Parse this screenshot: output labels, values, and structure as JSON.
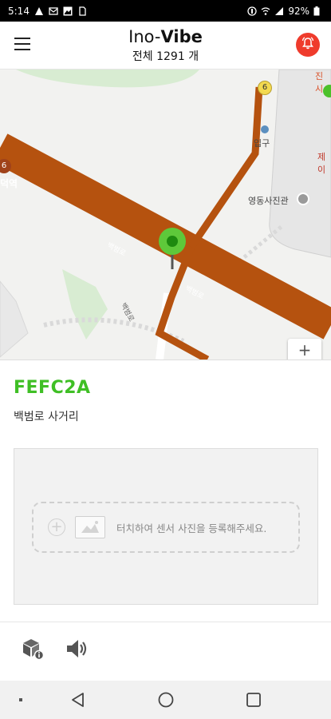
{
  "status": {
    "time": "5:14",
    "battery": "92%"
  },
  "header": {
    "brand_light": "Ino-",
    "brand_bold": "Vibe",
    "total": "전체 1291 개"
  },
  "map": {
    "labels": {
      "entrance": "입구",
      "studio": "영동사진관",
      "station": "덕역",
      "place_top_right": "진시",
      "place_right": "제이",
      "road_1": "백범로",
      "road_2": "백범로",
      "road_3": "백범로"
    },
    "route_badge_top": "6",
    "route_badge_left": "6",
    "zoom_in": "+"
  },
  "sensor": {
    "id": "FEFC2A",
    "location": "백범로 사거리",
    "photo_prompt": "터치하여 센서 사진을 등록해주세요."
  },
  "colors": {
    "accent_green": "#3fbf25",
    "road": "#b5520f",
    "alarm": "#ef3b2c"
  }
}
